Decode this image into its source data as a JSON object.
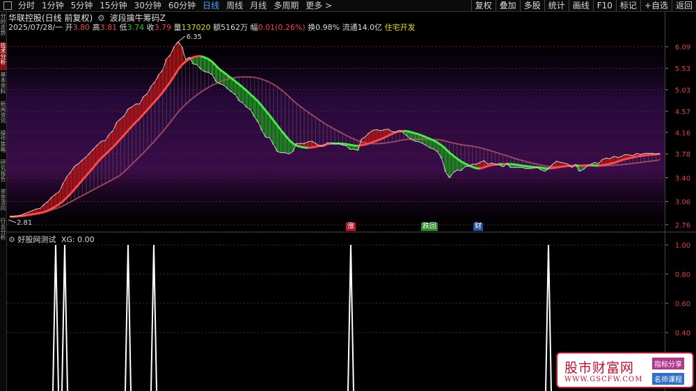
{
  "toolbar": {
    "periods": [
      "分时",
      "1分钟",
      "5分钟",
      "15分钟",
      "30分钟",
      "60分钟",
      "日线",
      "周线",
      "月线",
      "多周期",
      "更多 >"
    ],
    "active_period": "日线",
    "right_buttons": [
      "复权",
      "叠加",
      "多股",
      "统计",
      "画线",
      "F10",
      "标记",
      "+自选",
      "返回"
    ]
  },
  "left_tabs": [
    "分时走势",
    "技术分析",
    "基本资料",
    "新闻资讯",
    "操作策略",
    "研究报告",
    "资金流向",
    "行业分析"
  ],
  "header": {
    "stock": "华联控股(日线 前复权)",
    "indicator": "波段擒牛筹码Z"
  },
  "quote": {
    "date": "2025/07/28/一",
    "open_label": "开",
    "open": "3.80",
    "high_label": "高",
    "high": "3.81",
    "low_label": "低",
    "low": "3.74",
    "close_label": "收",
    "close": "3.79",
    "volume_label": "量",
    "volume": "137020",
    "amount_label": "额",
    "amount": "5162万",
    "change_label": "幅",
    "change": "0.01(0.26%)",
    "turnover_label": "换",
    "turnover": "0.98%",
    "float_label": "流通",
    "float": "14.0亿",
    "sector": "住宅开发"
  },
  "price_axis": [
    "6.09",
    "5.53",
    "5.03",
    "4.57",
    "4.16",
    "3.78",
    "3.40",
    "3.06",
    "2.76"
  ],
  "annotations": {
    "max": "6.35",
    "min": "2.81"
  },
  "badges": [
    {
      "text": "涨",
      "color": "#c0102a"
    },
    {
      "text": "跌回",
      "color": "#2a8a2a"
    },
    {
      "text": "财",
      "color": "#1f4f9f"
    }
  ],
  "sub": {
    "title": "好股网测试",
    "xg": "XG: 0.00",
    "axis": [
      "1.00",
      "0.80",
      "0.60",
      "0.40"
    ]
  },
  "chart_data": {
    "type": "line",
    "close": [
      2.86,
      2.86,
      2.87,
      2.88,
      2.9,
      2.92,
      2.94,
      2.96,
      2.97,
      3.02,
      3.06,
      3.12,
      3.16,
      3.2,
      3.32,
      3.42,
      3.49,
      3.58,
      3.62,
      3.68,
      3.73,
      3.8,
      3.87,
      3.94,
      4.0,
      4.01,
      4.12,
      4.19,
      4.35,
      4.42,
      4.48,
      4.62,
      4.66,
      4.72,
      4.72,
      4.88,
      4.94,
      5.11,
      5.21,
      5.38,
      5.49,
      5.77,
      5.87,
      6.09,
      6.22,
      6.09,
      5.75,
      5.81,
      5.64,
      5.62,
      5.51,
      5.45,
      5.43,
      5.37,
      5.21,
      5.16,
      5.13,
      5.05,
      4.98,
      4.92,
      4.79,
      4.74,
      4.65,
      4.6,
      4.46,
      4.35,
      4.19,
      4.07,
      4.06,
      3.94,
      3.82,
      3.8,
      3.8,
      3.78,
      3.82,
      3.96,
      3.96,
      3.96,
      3.99,
      4.0,
      3.96,
      3.92,
      3.91,
      3.97,
      3.97,
      3.95,
      3.96,
      3.93,
      3.92,
      3.86,
      3.86,
      3.84,
      4.04,
      4.08,
      4.15,
      4.2,
      4.21,
      4.19,
      4.21,
      4.22,
      4.17,
      4.17,
      4.2,
      4.15,
      4.09,
      4.03,
      4.0,
      3.99,
      3.96,
      3.92,
      3.88,
      3.86,
      3.81,
      3.7,
      3.49,
      3.4,
      3.48,
      3.52,
      3.51,
      3.57,
      3.58,
      3.61,
      3.61,
      3.64,
      3.67,
      3.61,
      3.63,
      3.61,
      3.6,
      3.57,
      3.62,
      3.56,
      3.56,
      3.56,
      3.56,
      3.54,
      3.54,
      3.55,
      3.56,
      3.52,
      3.5,
      3.55,
      3.61,
      3.66,
      3.64,
      3.63,
      3.61,
      3.56,
      3.61,
      3.5,
      3.53,
      3.58,
      3.61,
      3.64,
      3.62,
      3.69,
      3.71,
      3.7,
      3.74,
      3.72,
      3.74,
      3.77,
      3.76,
      3.75,
      3.79,
      3.77,
      3.79,
      3.79,
      3.79,
      3.78,
      3.79
    ],
    "signal_x": [
      80,
      93,
      184,
      221,
      504,
      788
    ],
    "ylim": [
      2.7,
      6.5
    ]
  }
}
